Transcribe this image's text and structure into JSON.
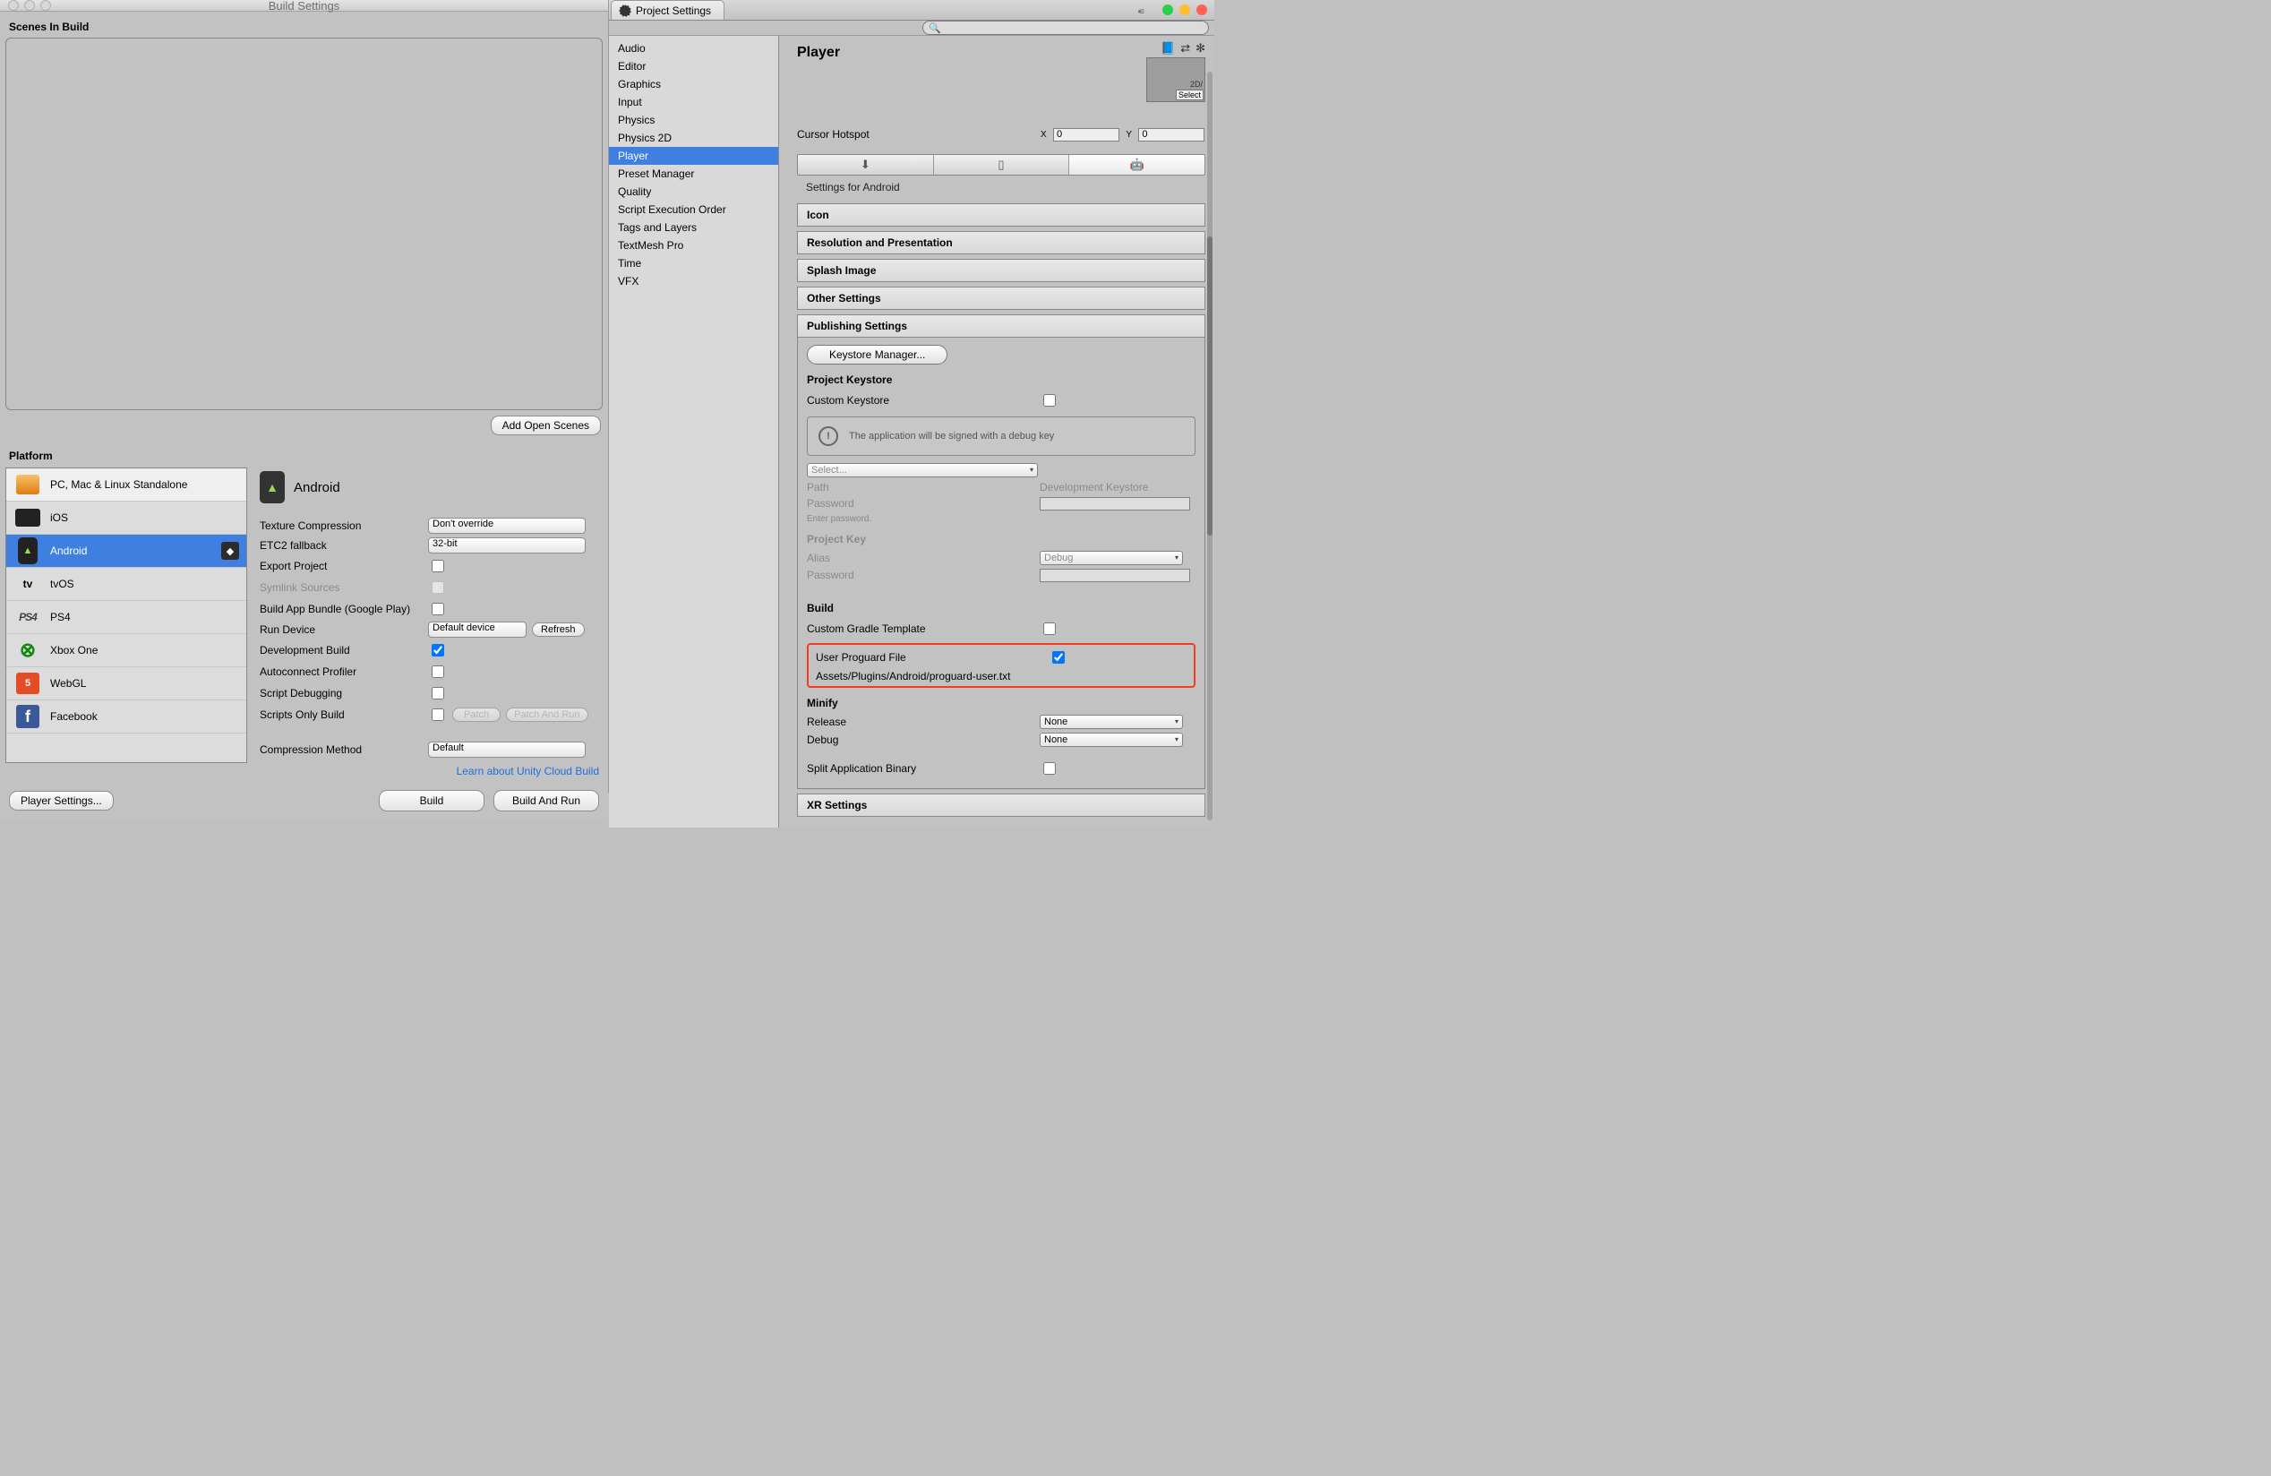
{
  "build": {
    "window_title": "Build Settings",
    "scenes_label": "Scenes In Build",
    "add_open_scenes": "Add Open Scenes",
    "platform_label": "Platform",
    "platforms": [
      {
        "name": "PC, Mac & Linux Standalone",
        "icon": "pc",
        "bright": true
      },
      {
        "name": "iOS",
        "icon": "ios"
      },
      {
        "name": "Android",
        "icon": "android",
        "selected": true,
        "unity": true
      },
      {
        "name": "tvOS",
        "icon": "tv"
      },
      {
        "name": "PS4",
        "icon": "ps"
      },
      {
        "name": "Xbox One",
        "icon": "xbox"
      },
      {
        "name": "WebGL",
        "icon": "webgl"
      },
      {
        "name": "Facebook",
        "icon": "fb"
      }
    ],
    "current_platform": "Android",
    "options": {
      "texture_compression": {
        "label": "Texture Compression",
        "value": "Don't override"
      },
      "etc2_fallback": {
        "label": "ETC2 fallback",
        "value": "32-bit"
      },
      "export_project": {
        "label": "Export Project",
        "checked": false
      },
      "symlink_sources": {
        "label": "Symlink Sources",
        "disabled": true
      },
      "build_app_bundle": {
        "label": "Build App Bundle (Google Play)",
        "checked": false
      },
      "run_device": {
        "label": "Run Device",
        "value": "Default device",
        "refresh": "Refresh"
      },
      "development_build": {
        "label": "Development Build",
        "checked": true
      },
      "autoconnect_profiler": {
        "label": "Autoconnect Profiler",
        "checked": false
      },
      "script_debugging": {
        "label": "Script Debugging",
        "checked": false
      },
      "scripts_only_build": {
        "label": "Scripts Only Build",
        "checked": false,
        "patch": "Patch",
        "patch_run": "Patch And Run"
      },
      "compression_method": {
        "label": "Compression Method",
        "value": "Default"
      }
    },
    "cloud_link": "Learn about Unity Cloud Build",
    "player_settings_btn": "Player Settings...",
    "build_btn": "Build",
    "build_run_btn": "Build And Run"
  },
  "ps": {
    "tab_title": "Project Settings",
    "search_placeholder": "",
    "nav": [
      "Audio",
      "Editor",
      "Graphics",
      "Input",
      "Physics",
      "Physics 2D",
      "Player",
      "Preset Manager",
      "Quality",
      "Script Execution Order",
      "Tags and Layers",
      "TextMesh Pro",
      "Time",
      "VFX"
    ],
    "nav_selected": "Player",
    "title": "Player",
    "preview_caption": "2D/",
    "preview_select": "Select",
    "cursor_hotspot": {
      "label": "Cursor Hotspot",
      "x_label": "X",
      "x": "0",
      "y_label": "Y",
      "y": "0"
    },
    "platform_section": "Settings for Android",
    "accordions": {
      "icon": "Icon",
      "resolution": "Resolution and Presentation",
      "splash": "Splash Image",
      "other": "Other Settings",
      "publishing": "Publishing Settings",
      "xr": "XR Settings"
    },
    "publishing": {
      "keystore_manager": "Keystore Manager...",
      "project_keystore": "Project Keystore",
      "custom_keystore": {
        "label": "Custom Keystore",
        "checked": false
      },
      "info": "The application will be signed with a debug key",
      "select": "Select...",
      "path": {
        "label": "Path",
        "value": "Development Keystore"
      },
      "password": {
        "label": "Password",
        "hint": "Enter password."
      },
      "project_key": "Project Key",
      "alias": {
        "label": "Alias",
        "value": "Debug"
      },
      "password2": {
        "label": "Password"
      },
      "build": "Build",
      "custom_gradle": {
        "label": "Custom Gradle Template",
        "checked": false
      },
      "user_proguard": {
        "label": "User Proguard File",
        "checked": true,
        "path": "Assets/Plugins/Android/proguard-user.txt"
      },
      "minify": "Minify",
      "release": {
        "label": "Release",
        "value": "None"
      },
      "debug": {
        "label": "Debug",
        "value": "None"
      },
      "split_binary": {
        "label": "Split Application Binary",
        "checked": false
      }
    }
  }
}
